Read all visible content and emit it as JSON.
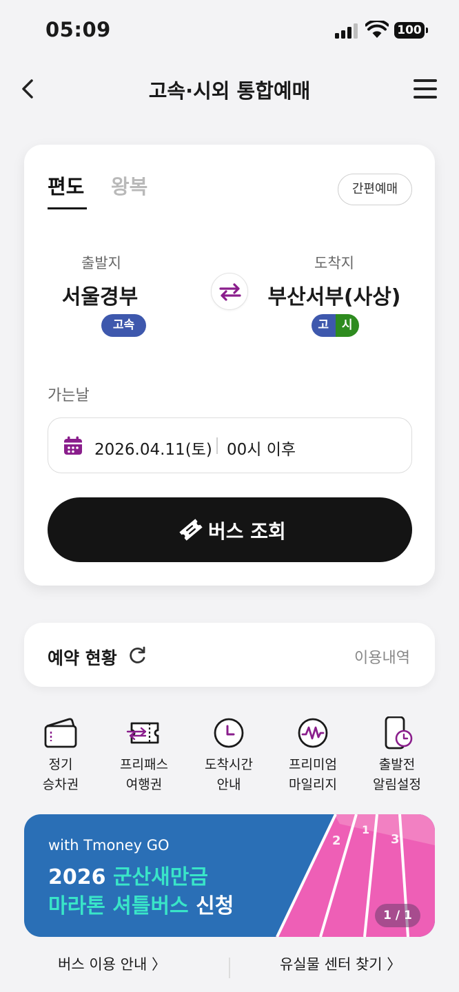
{
  "status_bar": {
    "time": "05:09",
    "battery": "100"
  },
  "header": {
    "title": "고속·시외 통합예매"
  },
  "trip_tabs": {
    "one_way": "편도",
    "round_trip": "왕복"
  },
  "quick_booking_label": "간편예매",
  "departure": {
    "label": "출발지",
    "name": "서울경부",
    "badge": "고속"
  },
  "arrival": {
    "label": "도착지",
    "name": "부산서부(사상)",
    "badge_express": "고",
    "badge_intercity": "시"
  },
  "date": {
    "label": "가는날",
    "value": "2026.04.11(토)",
    "time": "00시 이후"
  },
  "search_button_label": "버스 조회",
  "reservation": {
    "title": "예약 현황",
    "history_link": "이용내역"
  },
  "quick_menu": [
    {
      "label": "정기\n승차권",
      "icon": "wallet-icon"
    },
    {
      "label": "프리패스\n여행권",
      "icon": "ticket-pass-icon"
    },
    {
      "label": "도착시간\n안내",
      "icon": "clock-icon"
    },
    {
      "label": "프리미엄\n마일리지",
      "icon": "mileage-icon"
    },
    {
      "label": "출발전\n알림설정",
      "icon": "phone-alarm-icon"
    }
  ],
  "banner": {
    "subtitle": "with Tmoney GO",
    "line1_prefix": "2026 ",
    "line1_highlight": "군산새만금",
    "line2_highlight": "마라톤 셔틀버스",
    "line2_suffix": " 신청",
    "page_indicator": "1 / 1",
    "lane_numbers": [
      "2",
      "1",
      "3"
    ]
  },
  "footer": {
    "bus_guide": "버스 이용 안내 〉",
    "lost_found": "유실물 센터 찾기 〉"
  },
  "colors": {
    "purple": "#8a1e8c",
    "express_blue": "#3e58ad",
    "intercity_green": "#2e8b1f",
    "banner_blue": "#2a6fb6",
    "banner_pink": "#ee5fb6",
    "highlight": "#39e5c8"
  }
}
